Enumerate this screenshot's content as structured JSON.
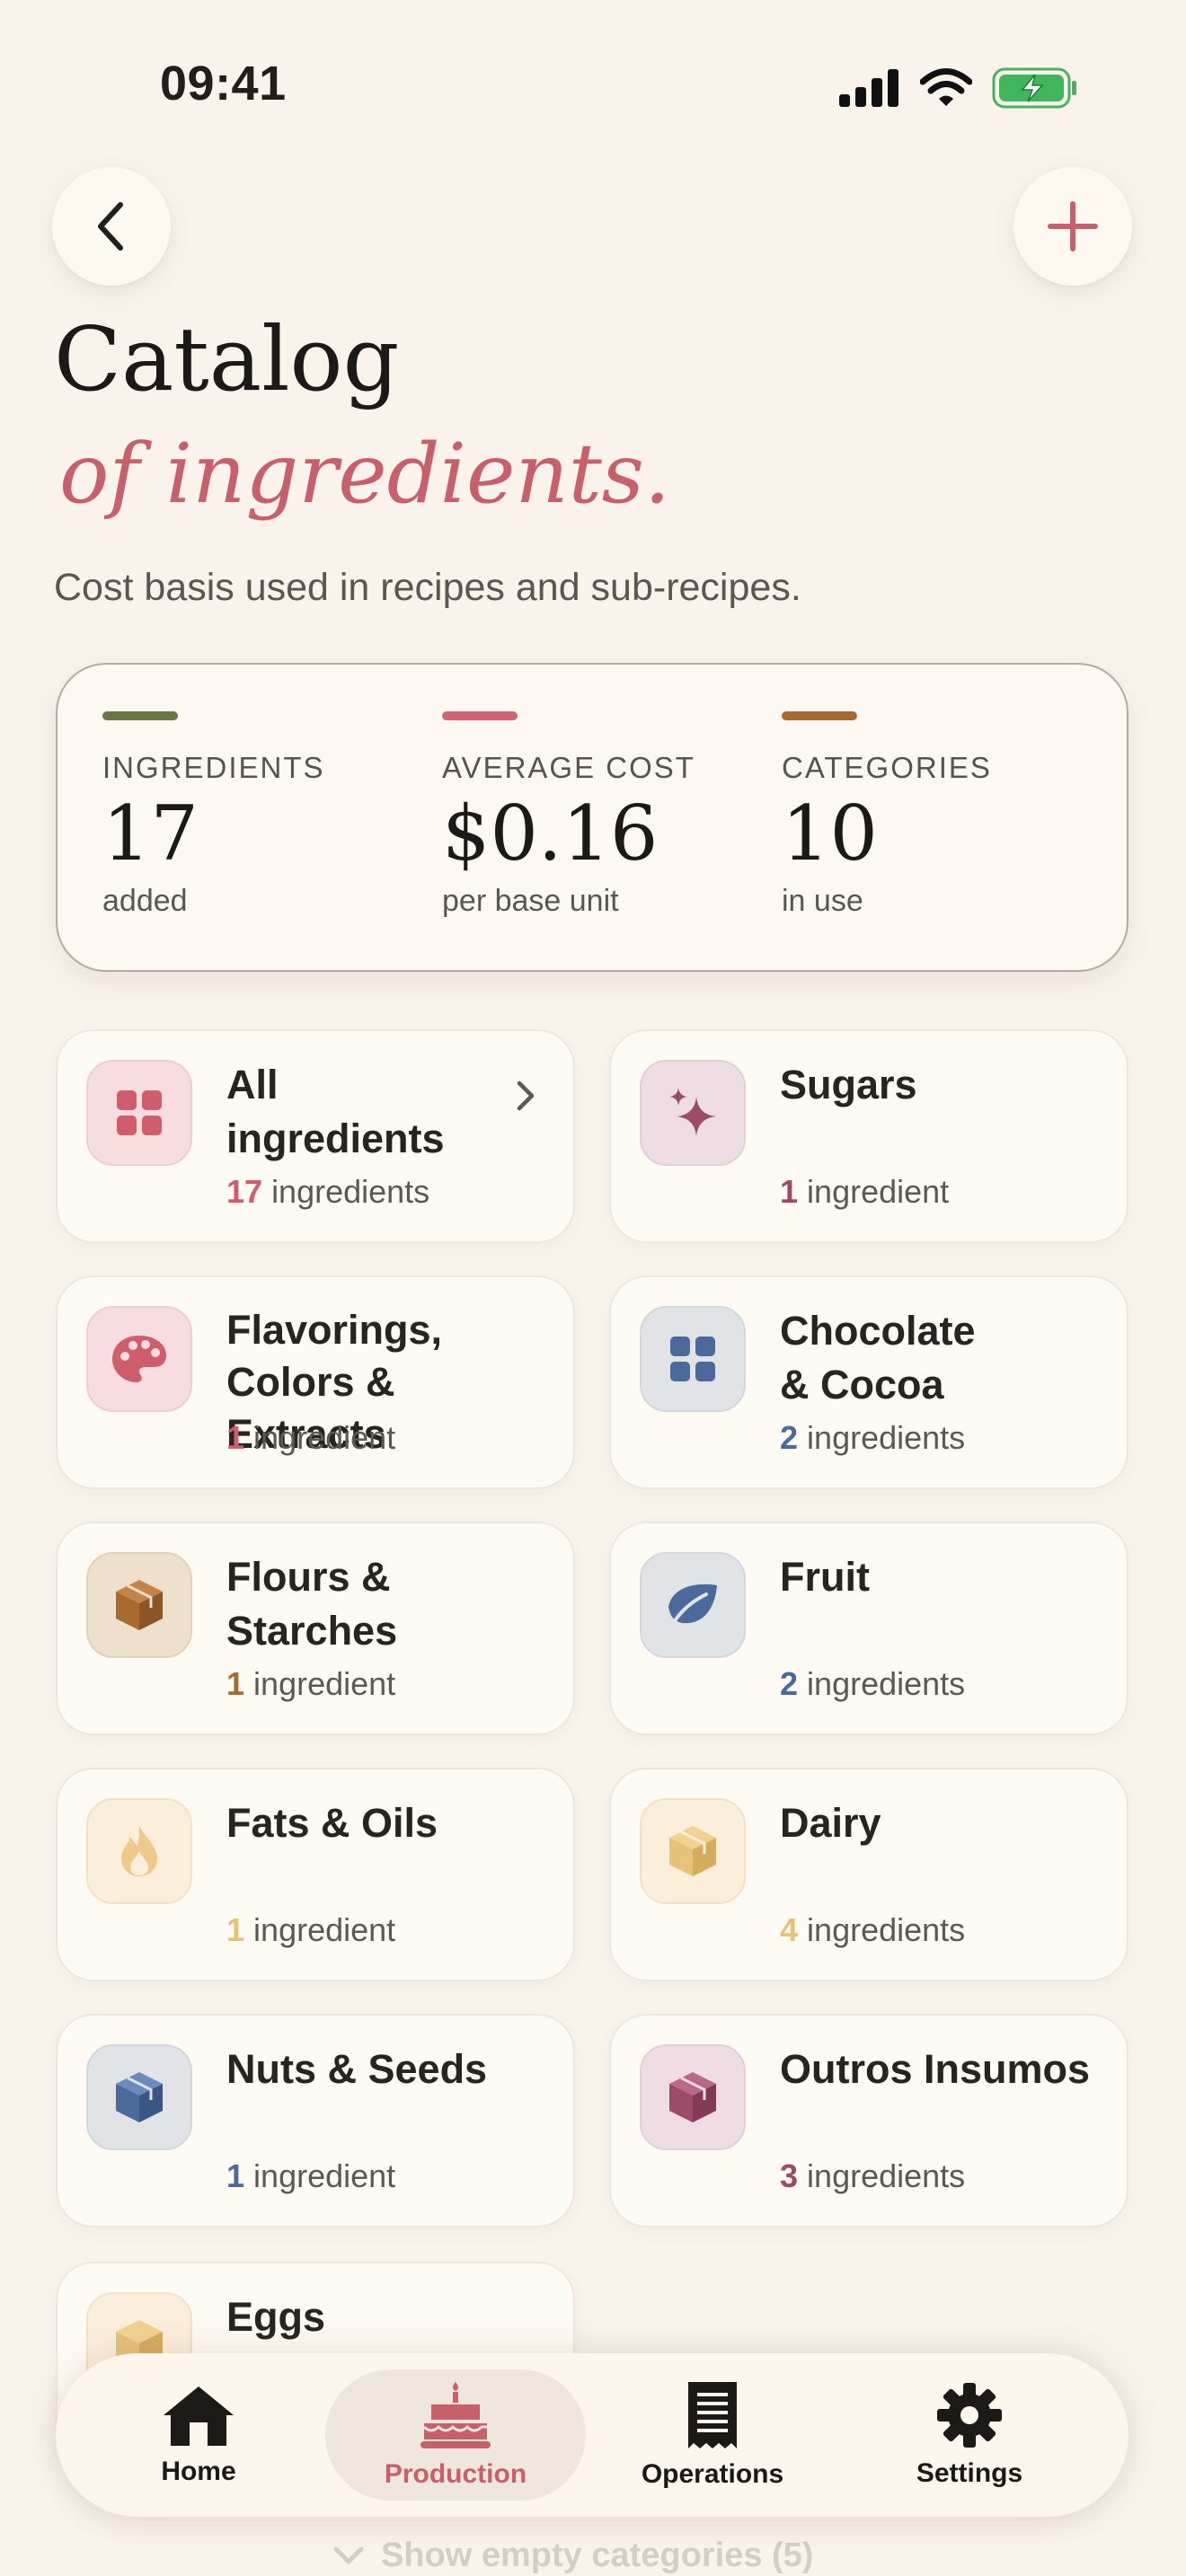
{
  "status_bar": {
    "time": "09:41"
  },
  "header": {
    "title": "Catalog",
    "title_accent": "of ingredients.",
    "subtitle": "Cost basis used in recipes and sub-recipes."
  },
  "stats": [
    {
      "label": "INGREDIENTS",
      "value": "17",
      "sub": "added",
      "color": "#6b7543"
    },
    {
      "label": "AVERAGE COST",
      "value": "$0.16",
      "sub": "per base unit",
      "color": "#cf6673"
    },
    {
      "label": "CATEGORIES",
      "value": "10",
      "sub": "in use",
      "color": "#a86a32"
    }
  ],
  "categories": [
    {
      "name": "All ingredients",
      "count": "17",
      "unit": "ingredients",
      "icon": "grid-icon",
      "color": "#d05d6c",
      "tile_bg": "#f7dde0"
    },
    {
      "name": "Sugars",
      "count": "1",
      "unit": "ingredient",
      "icon": "sparkle-icon",
      "color": "#9b4a68",
      "tile_bg": "#efdde3"
    },
    {
      "name": "Flavorings, Colors & Extracts",
      "count": "1",
      "unit": "ingredient",
      "icon": "palette-icon",
      "color": "#d05d6c",
      "tile_bg": "#f7dde0"
    },
    {
      "name": "Chocolate & Cocoa",
      "count": "2",
      "unit": "ingredients",
      "icon": "grid-icon",
      "color": "#4a6a9b",
      "tile_bg": "#e1e3e6"
    },
    {
      "name": "Flours & Starches",
      "count": "1",
      "unit": "ingredient",
      "icon": "box-icon",
      "color": "#a96a30",
      "tile_bg": "#efdfcd"
    },
    {
      "name": "Fruit",
      "count": "2",
      "unit": "ingredients",
      "icon": "leaf-icon",
      "color": "#4a6a9b",
      "tile_bg": "#e1e3e6"
    },
    {
      "name": "Fats & Oils",
      "count": "1",
      "unit": "ingredient",
      "icon": "flame-icon",
      "color": "#e6c27a",
      "tile_bg": "#fbeedb"
    },
    {
      "name": "Dairy",
      "count": "4",
      "unit": "ingredients",
      "icon": "box-icon",
      "color": "#e6c27a",
      "tile_bg": "#fbeedb"
    },
    {
      "name": "Nuts & Seeds",
      "count": "1",
      "unit": "ingredient",
      "icon": "box-icon",
      "color": "#4a6a9b",
      "tile_bg": "#e1e3e6"
    },
    {
      "name": "Outros Insumos",
      "count": "3",
      "unit": "ingredients",
      "icon": "box-icon",
      "color": "#9b4a68",
      "tile_bg": "#efdde3"
    },
    {
      "name": "Eggs",
      "icon": "box-icon",
      "color": "#e6c27a",
      "tile_bg": "#fbeedb"
    }
  ],
  "show_empty": "Show empty categories (5)",
  "nav": [
    {
      "label": "Home",
      "icon": "home-icon"
    },
    {
      "label": "Production",
      "icon": "cake-icon",
      "active": true
    },
    {
      "label": "Operations",
      "icon": "receipt-icon"
    },
    {
      "label": "Settings",
      "icon": "gear-icon"
    }
  ],
  "colors": {
    "accent": "#c7606a",
    "background": "#f9f3ec"
  }
}
